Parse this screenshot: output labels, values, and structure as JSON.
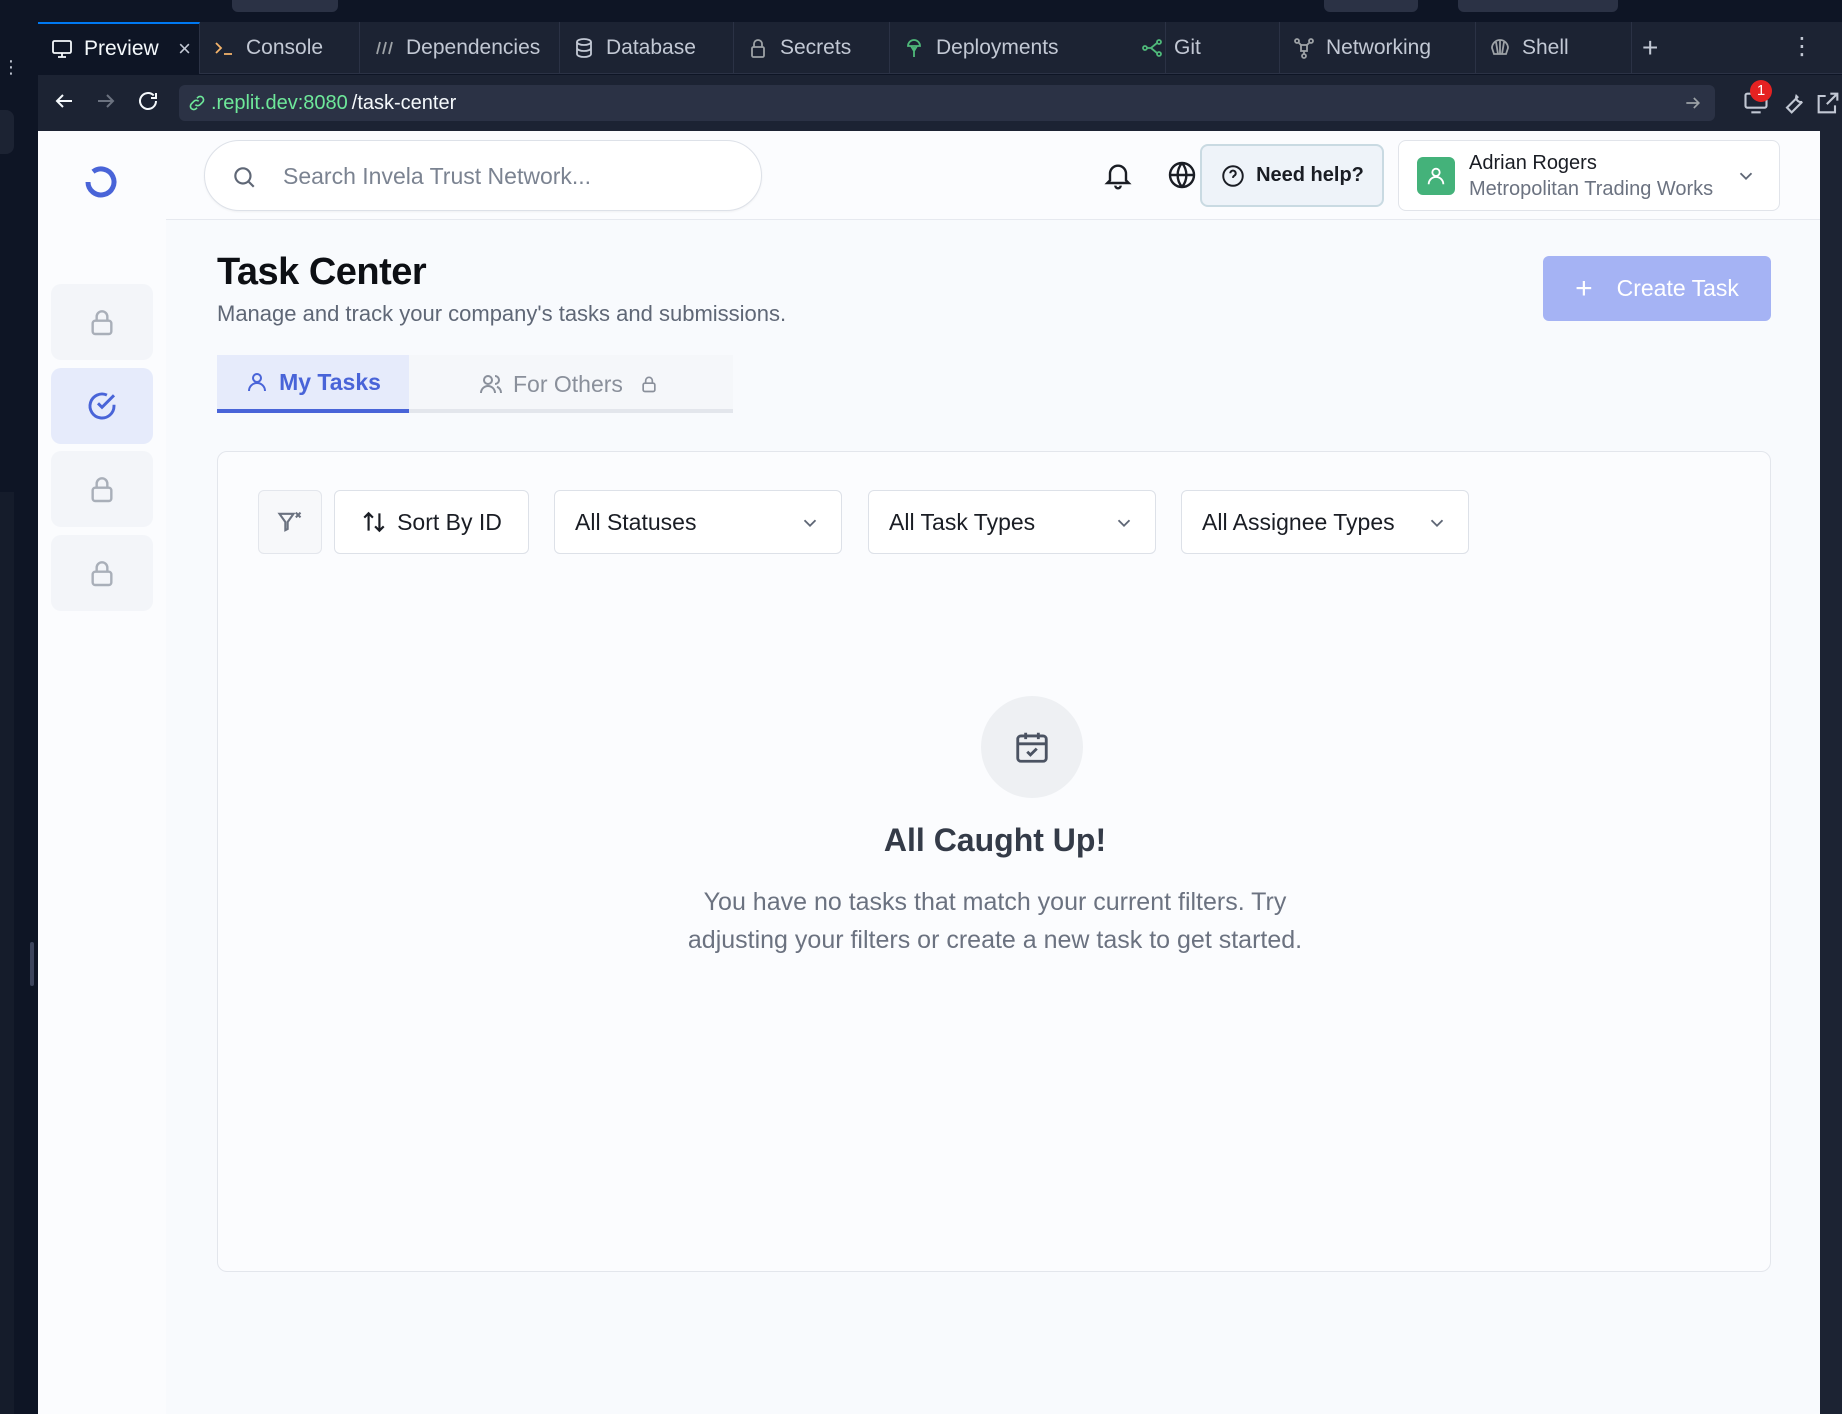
{
  "ide": {
    "tabs": [
      {
        "label": "Preview",
        "icon": "monitor-icon",
        "active": true
      },
      {
        "label": "Console",
        "icon": "terminal-icon"
      },
      {
        "label": "Dependencies",
        "icon": "dependencies-icon"
      },
      {
        "label": "Database",
        "icon": "database-icon"
      },
      {
        "label": "Secrets",
        "icon": "lock-icon"
      },
      {
        "label": "Deployments",
        "icon": "deployments-icon"
      },
      {
        "label": "Git",
        "icon": "git-icon"
      },
      {
        "label": "Networking",
        "icon": "networking-icon"
      },
      {
        "label": "Shell",
        "icon": "shell-icon"
      }
    ],
    "close_glyph": "×",
    "add_tab_glyph": "+",
    "more_glyph": "⋮",
    "url": {
      "host": ".replit.dev:8080",
      "path": "/task-center"
    },
    "notification_count": "1"
  },
  "header": {
    "search_placeholder": "Search Invela Trust Network...",
    "help_label": "Need help?",
    "user": {
      "name": "Adrian Rogers",
      "company": "Metropolitan Trading Works"
    }
  },
  "page": {
    "title": "Task Center",
    "subtitle": "Manage and track your company's tasks and submissions.",
    "create_button": "Create Task",
    "tabs": [
      {
        "label": "My Tasks",
        "active": true
      },
      {
        "label": "For Others",
        "locked": true
      }
    ]
  },
  "filters": {
    "sort_label": "Sort By ID",
    "status_selected": "All Statuses",
    "task_type_selected": "All Task Types",
    "assignee_type_selected": "All Assignee Types"
  },
  "empty_state": {
    "title": "All Caught Up!",
    "message": "You have no tasks that match your current filters. Try adjusting your filters or create a new task to get started."
  },
  "colors": {
    "brand": "#4964d8",
    "create_button": "#a5b3f4",
    "avatar": "#44b27a",
    "url_host": "#6ee89a"
  }
}
